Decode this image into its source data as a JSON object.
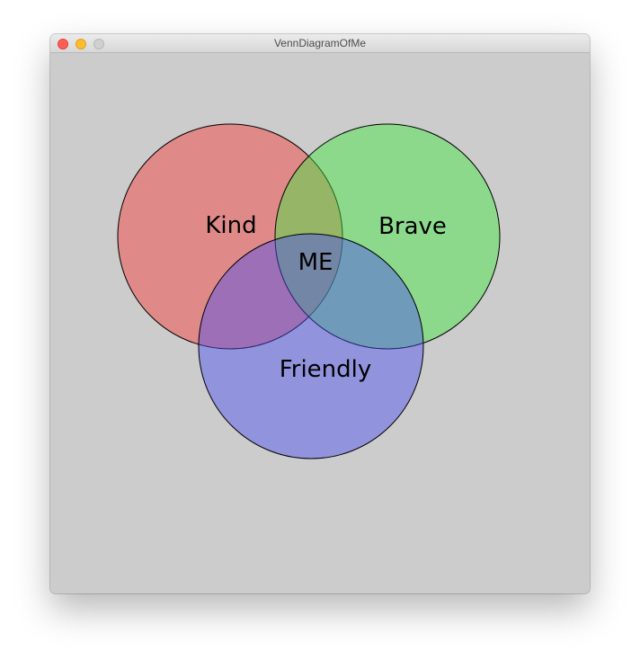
{
  "window": {
    "title": "VennDiagramOfMe"
  },
  "diagram": {
    "sets": [
      {
        "label": "Kind",
        "color": "#ef5350"
      },
      {
        "label": "Brave",
        "color": "#3ee83e"
      },
      {
        "label": "Friendly",
        "color": "#4b4ef1"
      }
    ],
    "center_label": "ME"
  }
}
